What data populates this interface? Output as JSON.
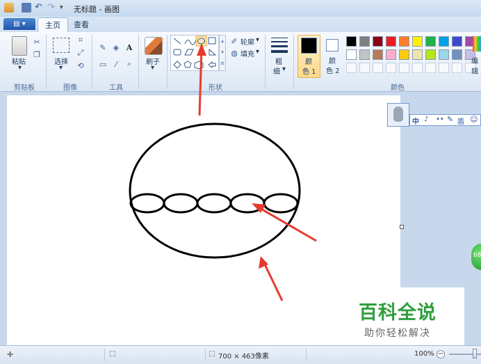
{
  "window": {
    "title": "无标题 - 画图"
  },
  "tabs": [
    {
      "label": "主页"
    },
    {
      "label": "查看"
    }
  ],
  "ribbon": {
    "clipboard": {
      "paste_label": "粘贴",
      "group_label": "剪贴板"
    },
    "image": {
      "select_label": "选择",
      "group_label": "图像"
    },
    "tools": {
      "text_tool": "A",
      "group_label": "工具"
    },
    "brushes": {
      "label": "刷子"
    },
    "shapes": {
      "outline_label": "轮廓",
      "fill_label": "填充",
      "group_label": "形状"
    },
    "size": {
      "label_line1": "粗",
      "label_line2": "细"
    },
    "colors": {
      "color1_line1": "颜",
      "color1_line2": "色 1",
      "color2_line1": "颜",
      "color2_line2": "色 2",
      "group_label": "颜色",
      "edit_label": "编辑",
      "active_color": "#000000",
      "secondary_color": "#ffffff",
      "palette_row1": [
        "#000000",
        "#7f7f7f",
        "#880015",
        "#ed1c24",
        "#ff7f27",
        "#fff200",
        "#22b14c",
        "#00a2e8",
        "#3f48cc",
        "#a349a4"
      ],
      "palette_row2": [
        "#ffffff",
        "#c3c3c3",
        "#b97a57",
        "#ffaec9",
        "#ffc90e",
        "#efe4b0",
        "#b5e61d",
        "#99d9ea",
        "#7092be",
        "#c8bfe7"
      ]
    }
  },
  "status": {
    "canvas_size": "700 × 463像素",
    "zoom": "100%"
  },
  "ime": {
    "items": [
      "中",
      "♪",
      "••",
      "🔧",
      "盾",
      "☺"
    ]
  },
  "badge": {
    "text": "68"
  },
  "watermark": {
    "title": "百科全说",
    "subtitle": "助你轻松解决"
  }
}
